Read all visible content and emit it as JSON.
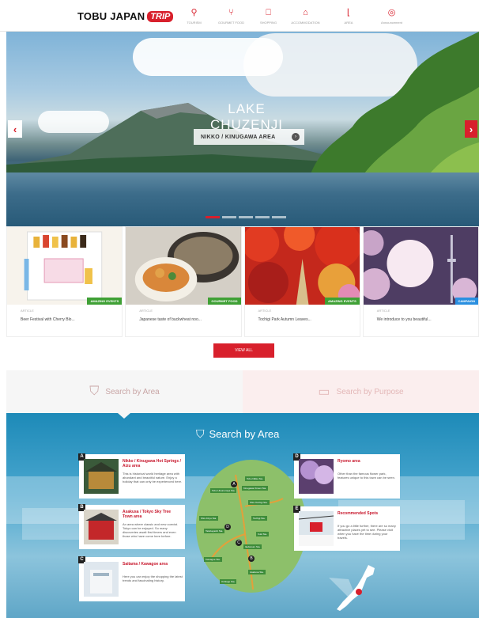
{
  "header": {
    "logo_text": "TOBU JAPAN",
    "logo_badge": "TRIP",
    "nav": [
      {
        "icon": "map-pin-icon",
        "glyph": "⚲",
        "label": "TOURISM"
      },
      {
        "icon": "fork-knife-icon",
        "glyph": "⑂",
        "label": "GOURMET FOOD"
      },
      {
        "icon": "shopping-bag-icon",
        "glyph": "⎕",
        "label": "SHOPPING"
      },
      {
        "icon": "hotel-icon",
        "glyph": "⌂",
        "label": "ACCOMMODATION"
      },
      {
        "icon": "area-icon",
        "glyph": "⌊",
        "label": "AREA"
      },
      {
        "icon": "announcement-icon",
        "glyph": "◎",
        "label": "Announcement"
      }
    ]
  },
  "hero": {
    "title": "LAKE CHUZENJI",
    "area_label": "NIKKO / KINUGAWA AREA",
    "slide_count": 5,
    "active_slide": 0
  },
  "cards": [
    {
      "category": "ARTICLE",
      "badge": "AMAZING EVENTS",
      "badge_color": "#3fa035",
      "desc": "Beer Festival with Cherry Blo..."
    },
    {
      "category": "ARTICLE",
      "badge": "GOURMET FOOD",
      "badge_color": "#3fa035",
      "desc": "Japanese taste of buckwheat noo..."
    },
    {
      "category": "ARTICLE",
      "badge": "AMAZING EVENTS",
      "badge_color": "#3fa035",
      "desc": "Tochigi Park Autumn Leaves..."
    },
    {
      "category": "ARTICLE",
      "badge": "CAMPAIGN",
      "badge_color": "#2a8fe0",
      "desc": "We introduce to you beautiful..."
    }
  ],
  "view_all_label": "VIEW ALL",
  "search_tabs": {
    "area_label": "Search by Area",
    "purpose_label": "Search by Purpose"
  },
  "area_section": {
    "heading": "Search by Area",
    "areas": [
      {
        "letter": "A",
        "title": "Nikko / Kinugawa Hot Springs / Aizu area",
        "desc": "This is historical world heritage area with abundant and beautiful nature. Enjoy a holiday that can only be experienced here."
      },
      {
        "letter": "B",
        "title": "Asakusa / Tokyo Sky Tree Town area",
        "desc": "An area where classic and new coexist. Tokyo can be enjoyed. So many discoveries await first timers and even those who have come here before."
      },
      {
        "letter": "C",
        "title": "Saitama / Kawagoe area",
        "desc": "Here you can enjoy the shopping the latest trends and fascinating history."
      },
      {
        "letter": "D",
        "title": "Ryomo area",
        "desc": "Other than the famous flower park, features unique to this town can be seen."
      },
      {
        "letter": "E",
        "title": "Recommended Spots",
        "desc": "If you go a little further, there are so many attractive places yet to see. Please visit when you have the time during your travels."
      }
    ],
    "stations": [
      "Tobu Nikko Sta.",
      "Kinugawa Onsen Sta.",
      "Shin-Tochigi Sta.",
      "Tochigi Sta.",
      "Shin-Kiryu Sta.",
      "Tatebayashi Sta.",
      "Kuki Sta.",
      "Ikebukuro Sta.",
      "Asakusa Sta.",
      "Oshiage Sta.",
      "Kawagoe Sta.",
      "Tobu Utsunomiya Sta."
    ],
    "colors": {
      "accent": "#d8202c",
      "map_green": "#8dc06a"
    }
  }
}
